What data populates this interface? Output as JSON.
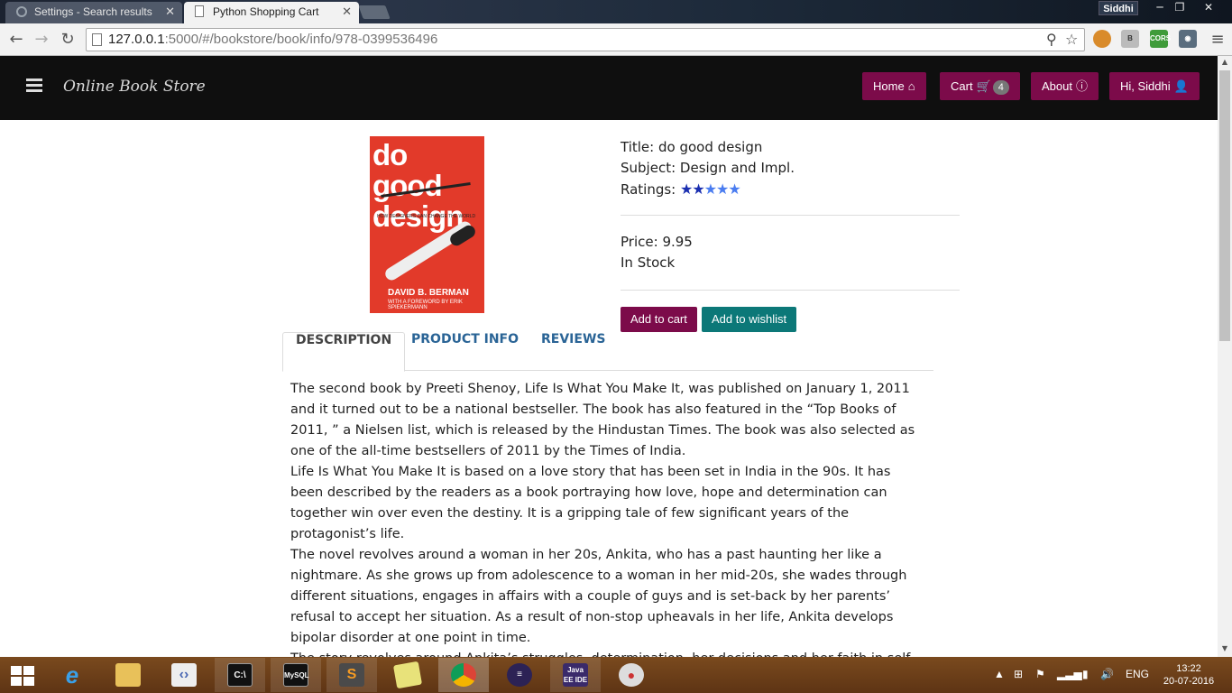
{
  "browser": {
    "tabs": [
      {
        "title": "Settings - Search results",
        "active": false
      },
      {
        "title": "Python Shopping Cart",
        "active": true
      }
    ],
    "profile": "Siddhi",
    "url_host": "127.0.0.1",
    "url_rest": ":5000/#/bookstore/book/info/978-0399536496",
    "extensions": [
      "B",
      "CORS"
    ]
  },
  "app_nav": {
    "brand": "Online Book Store",
    "home": "Home",
    "cart": "Cart",
    "cart_count": "4",
    "about": "About",
    "user": "Hi, Siddhi"
  },
  "cover": {
    "title": "do good design",
    "author": "DAVID B. BERMAN",
    "foreword": "WITH A FOREWORD BY ERIK SPIEKERMANN",
    "tagline": "HOW DESIGNERS CAN CHANGE THE WORLD"
  },
  "book": {
    "title_label": "Title:",
    "title": "do good design",
    "subject_label": "Subject:",
    "subject": "Design and Impl.",
    "ratings_label": "Ratings:",
    "rating": 2,
    "rating_max": 5,
    "price_label": "Price:",
    "price": "9.95",
    "stock": "In Stock",
    "add_to_cart": "Add to cart",
    "add_to_wishlist": "Add to wishlist"
  },
  "product_tabs": [
    "DESCRIPTION",
    "PRODUCT INFO",
    "REVIEWS"
  ],
  "description": [
    "The second book by Preeti Shenoy, Life Is What You Make It, was published on January 1, 2011 and it turned out to be a national bestseller. The book has also featured in the “Top Books of 2011, ” a Nielsen list, which is released by the Hindustan Times. The book was also selected as one of the all-time bestsellers of 2011 by the Times of India.",
    "Life Is What You Make It is based on a love story that has been set in India in the 90s. It has been described by the readers as a book portraying how love, hope and determination can together win over even the destiny. It is a gripping tale of few significant years of the protagonist’s life.",
    "The novel revolves around a woman in her 20s, Ankita, who has a past haunting her like a nightmare. As she grows up from adolescence to a woman in her mid-20s, she wades through different situations, engages in affairs with a couple of guys and is set-back by her parents’ refusal to accept her situation. As a result of non-stop upheavals in her life, Ankita develops bipolar disorder at one point in time.",
    "The story revolves around Ankita’s struggles, determination, her decisions and her faith in self. The book beautifully describes how she gets associated with her bipolar disorder and"
  ],
  "taskbar": {
    "language": "ENG",
    "time": "13:22",
    "date": "20-07-2016",
    "apps": [
      "Internet Explorer",
      "File Explorer",
      "Visual Studio",
      "Command Prompt",
      "MySQL",
      "Sublime Text",
      "Sticky Notes",
      "Chrome",
      "Eclipse",
      "Java EE IDE",
      "Paint"
    ]
  },
  "colors": {
    "nav_bg": "#0f0f0f",
    "accent_pill": "#7c0b4a",
    "wishlist_btn": "#0c7878",
    "tab_link": "#2a6496",
    "star": "#1a2fb0"
  }
}
